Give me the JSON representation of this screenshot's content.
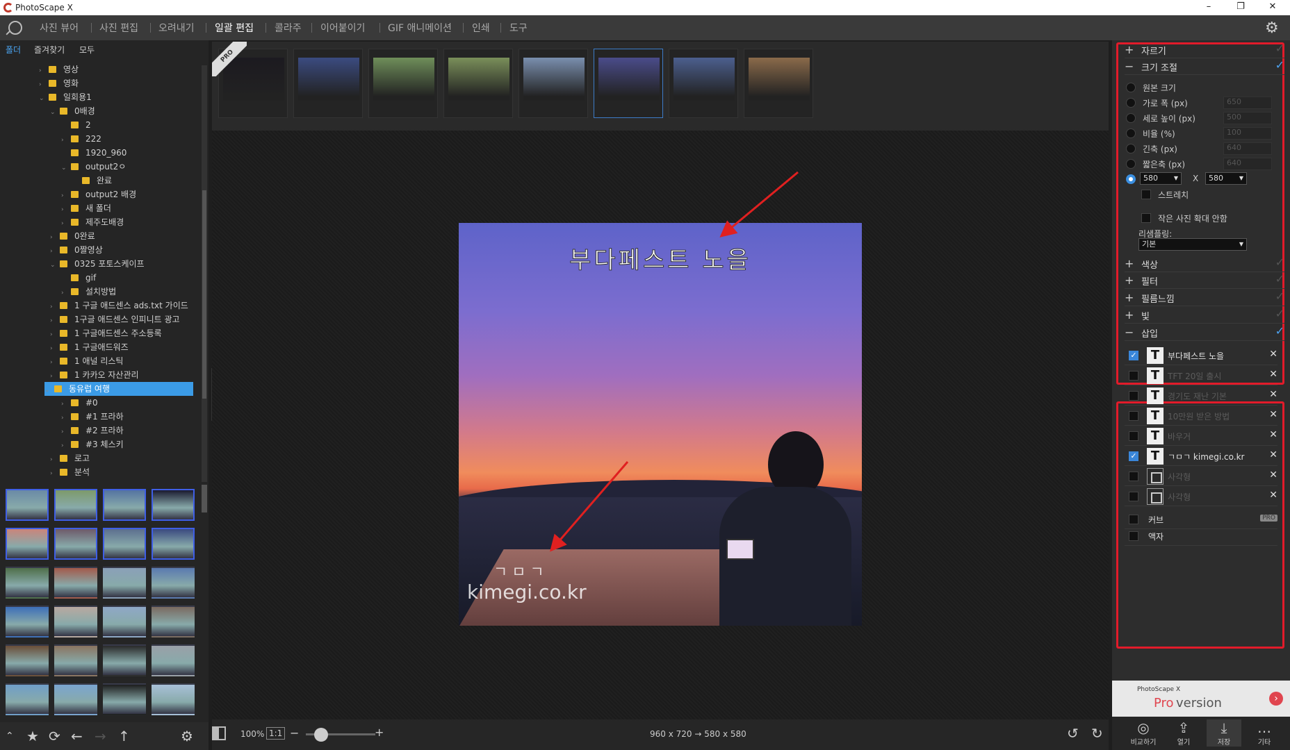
{
  "app": {
    "title": "PhotoScape X",
    "window_controls": [
      "–",
      "❐",
      "✕"
    ]
  },
  "menu": {
    "items": [
      "사진 뷰어",
      "사진 편집",
      "오려내기",
      "일괄 편집",
      "콜라주",
      "이어붙이기",
      "GIF 애니메이션",
      "인쇄",
      "도구"
    ],
    "active": "일괄 편집"
  },
  "left_tabs": {
    "folder": "폴더",
    "favorites": "즐겨찾기",
    "all": "모두"
  },
  "tree": [
    {
      "label": "영상",
      "level": 1,
      "arrow": "›"
    },
    {
      "label": "영화",
      "level": 1,
      "arrow": "›"
    },
    {
      "label": "일회용1",
      "level": 1,
      "arrow": "⌄"
    },
    {
      "label": "0배경",
      "level": 2,
      "arrow": "⌄"
    },
    {
      "label": "2",
      "level": 3,
      "arrow": ""
    },
    {
      "label": "222",
      "level": 3,
      "arrow": "›"
    },
    {
      "label": "1920_960",
      "level": 3,
      "arrow": ""
    },
    {
      "label": "output2ㅇ",
      "level": 3,
      "arrow": "⌄"
    },
    {
      "label": "완료",
      "level": 4,
      "arrow": ""
    },
    {
      "label": "output2 배경",
      "level": 3,
      "arrow": "›"
    },
    {
      "label": "새 폴더",
      "level": 3,
      "arrow": "›"
    },
    {
      "label": "제주도배경",
      "level": 3,
      "arrow": "›"
    },
    {
      "label": "0완료",
      "level": 2,
      "arrow": "›"
    },
    {
      "label": "0짤영상",
      "level": 2,
      "arrow": "›"
    },
    {
      "label": "0325 포토스케이프",
      "level": 2,
      "arrow": "⌄"
    },
    {
      "label": "gif",
      "level": 3,
      "arrow": ""
    },
    {
      "label": "설치방법",
      "level": 3,
      "arrow": "›"
    },
    {
      "label": "1 구글 애드센스 ads.txt 가이드",
      "level": 2,
      "arrow": "›"
    },
    {
      "label": "1구글 애드센스 인피니트 광고",
      "level": 2,
      "arrow": "›"
    },
    {
      "label": "1 구글애드센스 주소등록",
      "level": 2,
      "arrow": "›"
    },
    {
      "label": "1 구글애드워즈",
      "level": 2,
      "arrow": "›"
    },
    {
      "label": "1 애널 리스틱",
      "level": 2,
      "arrow": "›"
    },
    {
      "label": "1 카카오 자산관리",
      "level": 2,
      "arrow": "›"
    },
    {
      "label": "동유럽 여행",
      "level": 2,
      "arrow": "⌄",
      "selected": true
    },
    {
      "label": "#0",
      "level": 3,
      "arrow": "›"
    },
    {
      "label": "#1 프라하",
      "level": 3,
      "arrow": "›"
    },
    {
      "label": "#2 프라하",
      "level": 3,
      "arrow": "›"
    },
    {
      "label": "#3 체스키",
      "level": 3,
      "arrow": "›"
    },
    {
      "label": "로고",
      "level": 2,
      "arrow": "›"
    },
    {
      "label": "분석",
      "level": 2,
      "arrow": "›"
    }
  ],
  "thumb_colors": [
    "#6a8aa6",
    "#7d9a6b",
    "#5574a1",
    "#1a1a30",
    "#c9857c",
    "#6d5a6a",
    "#5c6f8f",
    "#3a4a80",
    "#4f6f4a",
    "#a35a4b",
    "#8aa0b8",
    "#5a7ab0",
    "#3d6fb8",
    "#b8a9a0",
    "#8fa8c6",
    "#7a6a60",
    "#6a4e38",
    "#8a7460",
    "#2a2a2a",
    "#9aa0a8",
    "#6f9ec8",
    "#7aa5d0",
    "#1e1e1e",
    "#a8c0d8"
  ],
  "thumb_selected": [
    0,
    1,
    2,
    3,
    4,
    5,
    6,
    7
  ],
  "filmstrip": {
    "pro_ribbon": "PRO",
    "colors": [
      "#1c1a20",
      "#3b4b80",
      "#6f8e5a",
      "#7a8f5a",
      "#7a8fae",
      "#4a4c8a",
      "#4c5f8e",
      "#8a6a4a"
    ],
    "selected": 5
  },
  "photo": {
    "caption": "부다페스트 노을",
    "watermark_line1": "ㄱㅁㄱ",
    "watermark_line2": "kimegi.co.kr"
  },
  "bottom": {
    "zoom": "100%",
    "ratio": "1:1",
    "minus": "−",
    "plus": "+",
    "dimensions": "960 x 720 → 580 x 580"
  },
  "panel": {
    "crop": {
      "sign": "+",
      "label": "자르기",
      "checked": false
    },
    "resize": {
      "sign": "−",
      "label": "크기 조절",
      "checked": true
    },
    "resize_options": [
      {
        "label": "원본 크기",
        "value": "",
        "on": false
      },
      {
        "label": "가로 폭 (px)",
        "value": "650",
        "on": false
      },
      {
        "label": "세로 높이 (px)",
        "value": "500",
        "on": false
      },
      {
        "label": "비율 (%)",
        "value": "100",
        "on": false
      },
      {
        "label": "긴축 (px)",
        "value": "640",
        "on": false
      },
      {
        "label": "짧은축 (px)",
        "value": "640",
        "on": false
      }
    ],
    "custom": {
      "w": "580",
      "x": "X",
      "h": "580"
    },
    "stretch": "스트레치",
    "no_enlarge": "작은 사진 확대 안함",
    "resample_label": "리샘플링:",
    "resample_value": "기본",
    "color": {
      "sign": "+",
      "label": "색상"
    },
    "filter": {
      "sign": "+",
      "label": "필터"
    },
    "film": {
      "sign": "+",
      "label": "필름느낌"
    },
    "light": {
      "sign": "+",
      "label": "빛"
    },
    "insert": {
      "sign": "−",
      "label": "삽입",
      "checked": true
    },
    "insert_items": [
      {
        "type": "T",
        "label": "부다페스트 노을",
        "on": true
      },
      {
        "type": "T",
        "label": "TFT 20일 출시",
        "on": false
      },
      {
        "type": "T",
        "label": "경기도 재난 기본",
        "on": false
      },
      {
        "type": "T",
        "label": "10만원 받은 방법",
        "on": false
      },
      {
        "type": "T",
        "label": "바우거",
        "on": false
      },
      {
        "type": "T",
        "label": "ㄱㅁㄱ kimegi.co.kr",
        "on": true
      },
      {
        "type": "box",
        "label": "사각형",
        "on": false
      },
      {
        "type": "box",
        "label": "사각형",
        "on": false
      }
    ],
    "curve": "커브",
    "curve_badge": "PRO",
    "frame": "액자"
  },
  "ad": {
    "brand": "PhotoScape X",
    "pro": "Pro",
    "version": " version"
  },
  "actions": [
    {
      "icon": "◎",
      "label": "비교하기"
    },
    {
      "icon": "⇪",
      "label": "열기"
    },
    {
      "icon": "⤓",
      "label": "저장"
    },
    {
      "icon": "…",
      "label": "기타"
    }
  ]
}
